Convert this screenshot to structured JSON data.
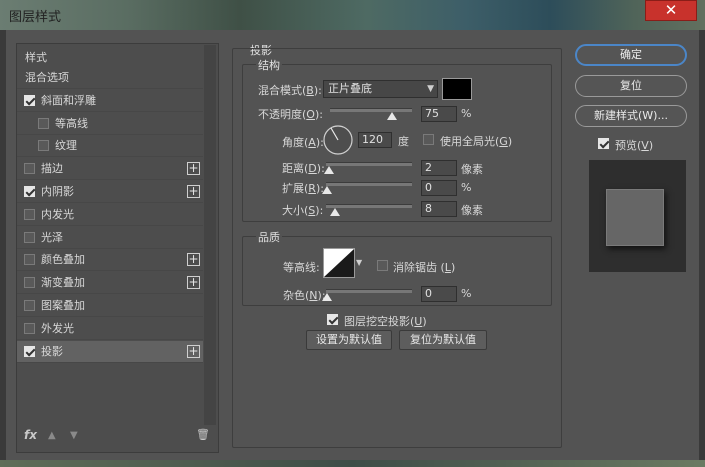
{
  "window": {
    "title": "图层样式",
    "close_glyph": "✕"
  },
  "left_panel": {
    "header": "样式",
    "items": [
      {
        "label": "混合选项",
        "checkbox": false,
        "checked": false,
        "plus": false
      },
      {
        "label": "斜面和浮雕",
        "checkbox": true,
        "checked": true,
        "plus": false
      },
      {
        "label": "等高线",
        "checkbox": true,
        "checked": false,
        "plus": false,
        "indent": true
      },
      {
        "label": "纹理",
        "checkbox": true,
        "checked": false,
        "plus": false,
        "indent": true
      },
      {
        "label": "描边",
        "checkbox": true,
        "checked": false,
        "plus": true
      },
      {
        "label": "内阴影",
        "checkbox": true,
        "checked": true,
        "plus": true
      },
      {
        "label": "内发光",
        "checkbox": true,
        "checked": false,
        "plus": false
      },
      {
        "label": "光泽",
        "checkbox": true,
        "checked": false,
        "plus": false
      },
      {
        "label": "颜色叠加",
        "checkbox": true,
        "checked": false,
        "plus": true
      },
      {
        "label": "渐变叠加",
        "checkbox": true,
        "checked": false,
        "plus": true
      },
      {
        "label": "图案叠加",
        "checkbox": true,
        "checked": false,
        "plus": false
      },
      {
        "label": "外发光",
        "checkbox": true,
        "checked": false,
        "plus": false
      },
      {
        "label": "投影",
        "checkbox": true,
        "checked": true,
        "plus": true,
        "active": true
      }
    ],
    "footer": {
      "fx": "fx",
      "up": "▲",
      "down": "▼",
      "trash": "🗑"
    }
  },
  "drop_shadow": {
    "section_title": "投影",
    "structure": {
      "title": "结构",
      "blend_mode_label": "混合模式(",
      "blend_mode_key": "B",
      "blend_mode_value": "正片叠底",
      "shadow_color": "#000000",
      "opacity_label": "不透明度(",
      "opacity_key": "O",
      "opacity_value": "75",
      "opacity_level": 0.75,
      "percent": "%",
      "angle_label": "角度(",
      "angle_key": "A",
      "angle_value": "120",
      "angle_unit": "度",
      "global_light_label": "使用全局光(",
      "global_light_key": "G",
      "distance_label": "距离(",
      "distance_key": "D",
      "distance_value": "2",
      "spread_label": "扩展(",
      "spread_key": "R",
      "spread_value": "0",
      "size_label": "大小(",
      "size_key": "S",
      "size_value": "8",
      "px_unit": "像素"
    },
    "quality": {
      "title": "品质",
      "contour_label": "等高线:",
      "antialias_label": "消除锯齿 (",
      "antialias_key": "L",
      "noise_label": "杂色(",
      "noise_key": "N",
      "noise_value": "0",
      "percent": "%"
    },
    "knockout_label": "图层挖空投影(",
    "knockout_key": "U",
    "set_default": "设置为默认值",
    "reset_default": "复位为默认值"
  },
  "right": {
    "ok": "确定",
    "reset": "复位",
    "new_style": "新建样式(W)...",
    "preview_label": "预览(",
    "preview_key": "V"
  },
  "colors": {
    "accent": "#4b86c8",
    "close": "#c8322c"
  }
}
